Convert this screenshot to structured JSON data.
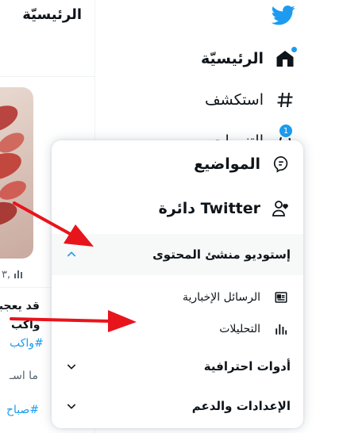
{
  "nav": {
    "items": [
      {
        "label": "الرئيسيّة",
        "icon": "home-icon",
        "active": true
      },
      {
        "label": "استكشف",
        "icon": "hashtag-icon"
      },
      {
        "label": "التنبيهات",
        "icon": "bell-icon",
        "badge": "1"
      }
    ]
  },
  "timeline": {
    "title": "الرئيسيّة",
    "stats": "٣,",
    "lines": [
      "قد يعجبـ",
      "واكب",
      "#واكب",
      "ما اسـ",
      "#صباح"
    ]
  },
  "menu": {
    "topics": "المواضيع",
    "circle": "دائرة Twitter",
    "creator_studio": "إستوديو منشئ المحتوى",
    "newsletters": "الرسائل الإخبارية",
    "analytics": "التحليلات",
    "professional_tools": "أدوات احترافية",
    "settings_support": "الإعدادات والدعم"
  },
  "colors": {
    "accent": "#1d9bf0",
    "arrow": "#e8141c"
  }
}
